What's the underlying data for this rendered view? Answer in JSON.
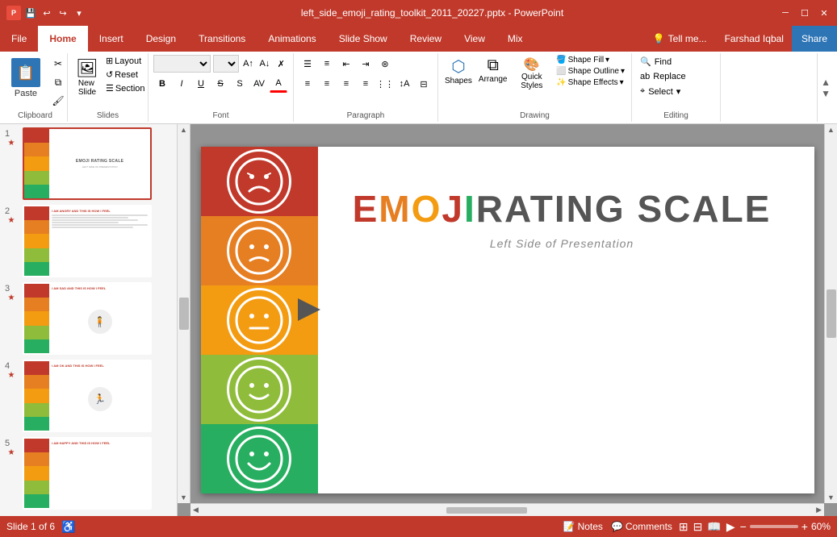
{
  "titleBar": {
    "appIcon": "P",
    "quickAccess": [
      "save",
      "undo",
      "redo",
      "customize"
    ],
    "title": "left_side_emoji_rating_toolkit_2011_20227.pptx - PowerPoint",
    "windowControls": [
      "minimize",
      "maximize",
      "close"
    ]
  },
  "ribbon": {
    "tabs": [
      "File",
      "Home",
      "Insert",
      "Design",
      "Transitions",
      "Animations",
      "Slide Show",
      "Review",
      "View",
      "Mix"
    ],
    "activeTab": "Home",
    "tellMe": "Tell me...",
    "userName": "Farshad Iqbal",
    "shareLabel": "Share",
    "groups": {
      "clipboard": {
        "label": "Clipboard",
        "paste": "Paste",
        "cut": "✂",
        "copy": "⧉",
        "formatPainter": "🖌"
      },
      "slides": {
        "label": "Slides",
        "newSlide": "New\nSlide",
        "layout": "Layout",
        "reset": "Reset",
        "section": "Section"
      },
      "font": {
        "label": "Font",
        "fontName": "",
        "fontSize": "",
        "bold": "B",
        "italic": "I",
        "underline": "U",
        "strikethrough": "S",
        "shadow": "S",
        "fontColor": "A"
      },
      "paragraph": {
        "label": "Paragraph"
      },
      "drawing": {
        "label": "Drawing",
        "shapes": "Shapes",
        "arrange": "Arrange",
        "quickStyles": "Quick\nStyles",
        "shapeFill": "Shape Fill",
        "shapeOutline": "Shape Outline",
        "shapeEffects": "Shape Effects"
      },
      "editing": {
        "label": "Editing",
        "find": "Find",
        "replace": "Replace",
        "select": "Select"
      }
    }
  },
  "slidePanel": {
    "slides": [
      {
        "num": "1",
        "title": "EMOJI RATING SCALE",
        "subtitle": "LEFT SIDE OF PRESENTATION",
        "type": "title"
      },
      {
        "num": "2",
        "title": "I AM ANGRY AND THIS IS HOW I FEEL",
        "type": "content"
      },
      {
        "num": "3",
        "title": "I AM SAD AND THIS IS HOW I FEEL",
        "type": "content"
      },
      {
        "num": "4",
        "title": "I AM OK AND THIS IS HOW I FEEL",
        "type": "content"
      },
      {
        "num": "5",
        "title": "I AM HAPPY AND THIS IS HOW I FEEL",
        "type": "content"
      }
    ]
  },
  "currentSlide": {
    "title1": "EMOJI",
    "titleRest": " RATING SCALE",
    "subtitle": "Left Side of Presentation",
    "emojiRows": [
      {
        "color": "#c0392b",
        "face": "sad-frown"
      },
      {
        "color": "#e67e22",
        "face": "slight-frown"
      },
      {
        "color": "#f39c12",
        "face": "neutral"
      },
      {
        "color": "#8fbc3a",
        "face": "slight-smile"
      },
      {
        "color": "#27ae60",
        "face": "big-smile"
      }
    ]
  },
  "statusBar": {
    "slideInfo": "Slide 1 of 6",
    "notes": "Notes",
    "comments": "Comments",
    "zoom": "60%"
  }
}
